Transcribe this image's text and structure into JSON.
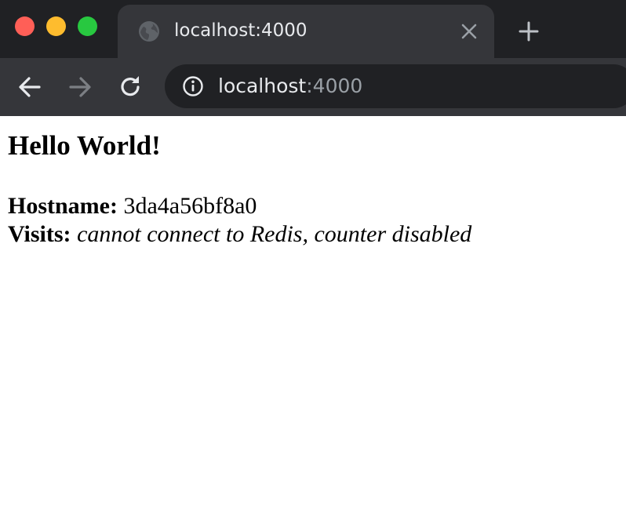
{
  "browser": {
    "tab": {
      "title": "localhost:4000",
      "favicon_icon": "globe-icon",
      "close_icon": "close-icon"
    },
    "new_tab_icon": "plus-icon",
    "toolbar": {
      "back_icon": "arrow-left-icon",
      "forward_icon": "arrow-right-icon",
      "reload_icon": "reload-icon",
      "site_info_icon": "info-icon"
    },
    "address_bar": {
      "host": "localhost",
      "port": ":4000"
    },
    "colors": {
      "tabstrip_bg": "#202124",
      "active_tab_bg": "#35363a",
      "toolbar_bg": "#35363a",
      "omnibox_bg": "#202124",
      "traffic_close": "#ff5f57",
      "traffic_minimize": "#febc2e",
      "traffic_zoom": "#28c840"
    }
  },
  "page": {
    "heading": "Hello World!",
    "hostname_label": "Hostname:",
    "hostname_value": "3da4a56bf8a0",
    "visits_label": "Visits:",
    "visits_value": "cannot connect to Redis, counter disabled"
  }
}
